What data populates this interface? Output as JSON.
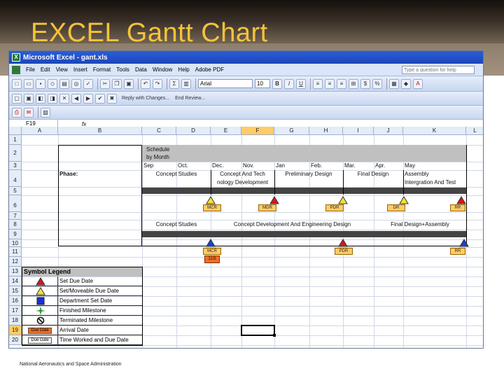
{
  "slide": {
    "title": "EXCEL Gantt Chart",
    "footer": "National Aeronautics and Space Administration"
  },
  "window": {
    "title": "Microsoft Excel - gant.xls"
  },
  "menu": [
    "File",
    "Edit",
    "View",
    "Insert",
    "Format",
    "Tools",
    "Data",
    "Window",
    "Help",
    "Adobe PDF"
  ],
  "help_placeholder": "Type a question for help",
  "toolbar": {
    "font": "Arial",
    "size": "10",
    "bold": "B",
    "italic": "I",
    "underline": "U",
    "reply_text": "Reply with Changes...",
    "end_review": "End Review..."
  },
  "formula_bar": {
    "name_box": "F19",
    "fx": "fx"
  },
  "columns": [
    "A",
    "B",
    "C",
    "D",
    "E",
    "F",
    "G",
    "H",
    "I",
    "J",
    "K",
    "L"
  ],
  "selected_column": "F",
  "rows": [
    "1",
    "2",
    "3",
    "4",
    "5",
    "6",
    "7",
    "8",
    "9",
    "10",
    "11",
    "12",
    "13",
    "14",
    "15",
    "16",
    "17",
    "18",
    "19",
    "20"
  ],
  "selected_row": "19",
  "sheet": {
    "schedule_header": "Schedule",
    "schedule_header2": "by Month",
    "months": [
      "Sep",
      "Oct.",
      "Dec.",
      "Nov.",
      "Jan",
      "Feb.",
      "Mar.",
      "Apr.",
      "May"
    ],
    "phase_label": "Phase:",
    "phases_top": [
      "Concept Studies",
      "Concept And Tech",
      "nology Development",
      "Preliminary Design",
      "Final Design",
      "Assembly",
      "Intergration And Test"
    ],
    "milestones_top": [
      "MCR",
      "MDR",
      "PDR",
      "DR",
      "RR"
    ],
    "phases_mid": [
      "Concept Studies",
      "Concept Development And Engineering Design",
      "Final Design+Assembly"
    ],
    "milestones_mid": [
      "MCR",
      "PDR",
      "RR"
    ],
    "milestone_date": "11/8"
  },
  "legend": {
    "header": "Symbol Legend",
    "items": [
      "Set Due Date",
      "Set/Moveable Due Date",
      "Department Set Date",
      "Finished Milestone",
      "Terminated Milestone",
      "Arrival Date",
      "Time Worked and Due Date"
    ],
    "due_date_label": "Due Date"
  },
  "colors": {
    "title": "#f5c33b",
    "red_triangle": "#d21a1a",
    "yellow_triangle": "#f5e23a",
    "blue_triangle": "#1f3fcf",
    "blue_square": "#1c2fd6",
    "green_star": "#2c9a3a"
  }
}
